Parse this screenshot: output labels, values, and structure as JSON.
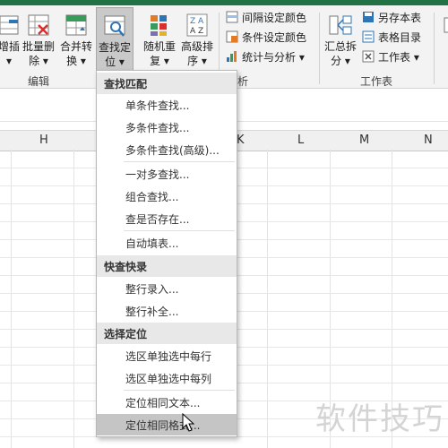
{
  "ribbon": {
    "buttons": {
      "insert": "增插",
      "insert_caret": "▾",
      "batch_delete_1": "批量删",
      "batch_delete_2": "除 ▾",
      "merge_1": "合并转",
      "merge_2": "换 ▾",
      "find_1": "查找定",
      "find_2": "位 ▾",
      "random_1": "随机重",
      "random_2": "复 ▾",
      "sort_1": "高级排",
      "sort_2": "序 ▾",
      "summary_1": "汇总拆",
      "summary_2": "分 ▾"
    },
    "small": {
      "interval_color": "间隔设定颜色",
      "condition_color": "条件设定颜色",
      "stats_analysis": "统计与分析 ▾",
      "save_as_sheet": "另存本表",
      "sheet_directory": "表格目录",
      "worksheet": "工作表 ▾"
    },
    "groups": {
      "edit": "编辑",
      "analysis": "析",
      "worksheet": "工作表"
    }
  },
  "columns": [
    "H",
    "K",
    "L",
    "M",
    "N"
  ],
  "menu": {
    "sections": [
      "查找匹配",
      "快查快录",
      "选择定位"
    ],
    "items_section1": [
      "单条件查找...",
      "多条件查找...",
      "多条件查找(高级)...",
      "一对多查找...",
      "组合查找...",
      "查是否存在...",
      "自动填表..."
    ],
    "items_section2": [
      "整行录入...",
      "整行补全..."
    ],
    "items_section3": [
      "选区单独选中每行",
      "选区单独选中每列",
      "定位相同文本...",
      "定位相同格式..."
    ]
  },
  "watermark": "软件技巧",
  "colors": {
    "accent": "#217346",
    "menu_highlight": "#c5c5c5",
    "section_bg": "#e8e8e8"
  }
}
